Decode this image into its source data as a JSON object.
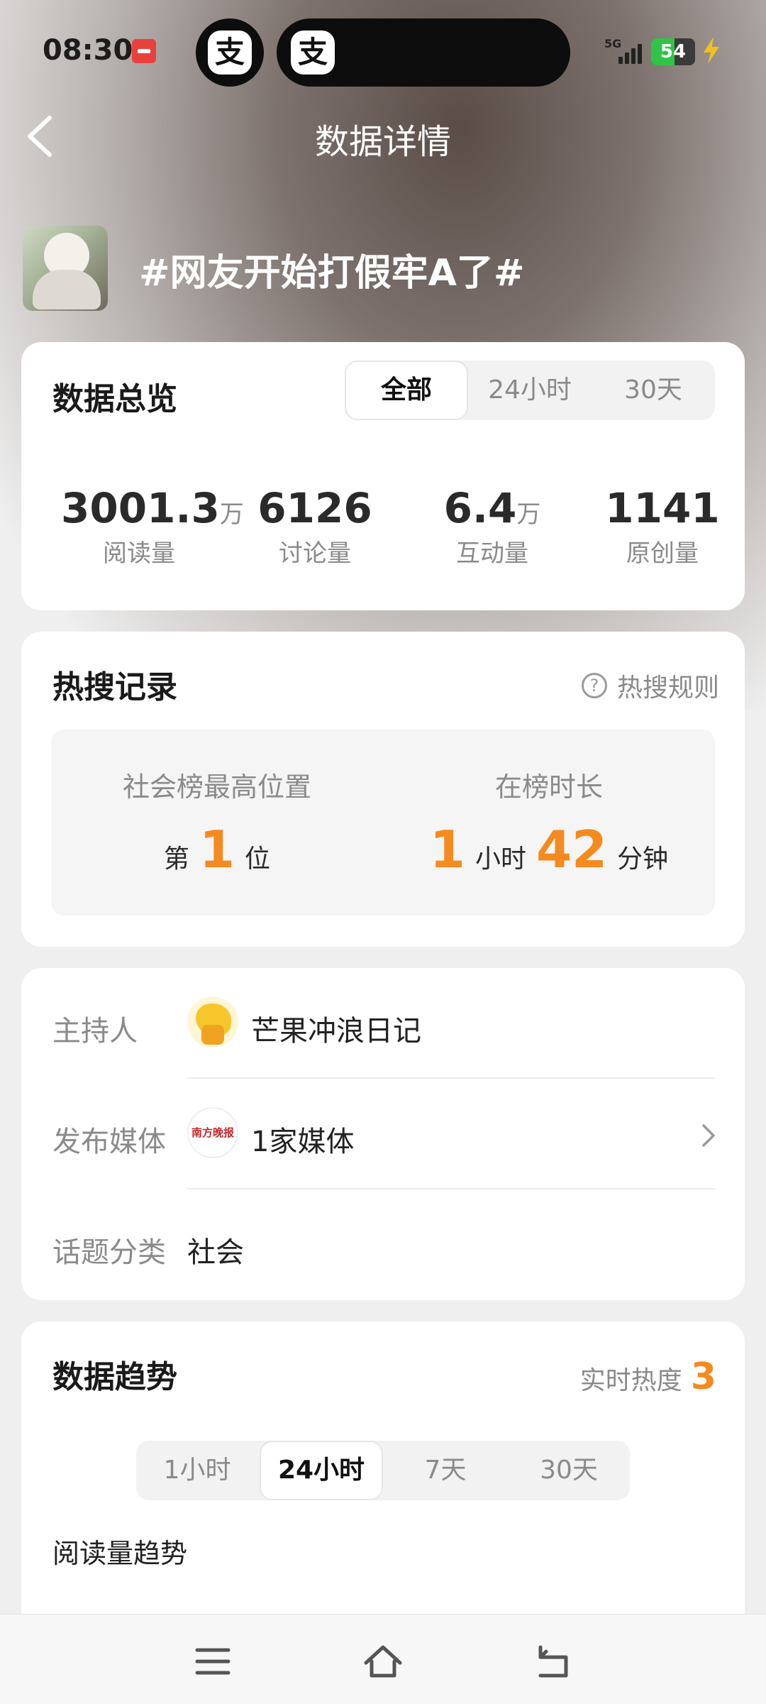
{
  "status": {
    "time": "08:30",
    "network": "5G",
    "battery": 54,
    "app_icon_glyph": "支"
  },
  "header": {
    "title": "数据详情"
  },
  "topic": {
    "title": "#网友开始打假牢A了#"
  },
  "overview": {
    "title": "数据总览",
    "tabs": [
      "全部",
      "24小时",
      "30天"
    ],
    "active_tab": 0,
    "stats": [
      {
        "value": "3001.3",
        "unit": "万",
        "label": "阅读量"
      },
      {
        "value": "6126",
        "unit": "",
        "label": "讨论量"
      },
      {
        "value": "6.4",
        "unit": "万",
        "label": "互动量"
      },
      {
        "value": "1141",
        "unit": "",
        "label": "原创量"
      }
    ]
  },
  "hot_search": {
    "title": "热搜记录",
    "rule_label": "热搜规则",
    "rule_icon": "?",
    "rank": {
      "label": "社会榜最高位置",
      "prefix": "第",
      "value": "1",
      "suffix": "位"
    },
    "duration": {
      "label": "在榜时长",
      "hours": "1",
      "hours_unit": "小时",
      "minutes": "42",
      "minutes_unit": "分钟"
    }
  },
  "info": {
    "host": {
      "label": "主持人",
      "value": "芒果冲浪日记",
      "avatar_icon": "mango-mascot-avatar"
    },
    "media": {
      "label": "发布媒体",
      "value": "1家媒体",
      "avatar_text": "南方晚报"
    },
    "category": {
      "label": "话题分类",
      "value": "社会"
    }
  },
  "trend": {
    "title": "数据趋势",
    "heat_label": "实时热度",
    "heat_value": "3",
    "tabs": [
      "1小时",
      "24小时",
      "7天",
      "30天"
    ],
    "active_tab": 1,
    "subtitle": "阅读量趋势"
  },
  "colors": {
    "accent": "#f58a1f",
    "battery": "#2fc447"
  }
}
